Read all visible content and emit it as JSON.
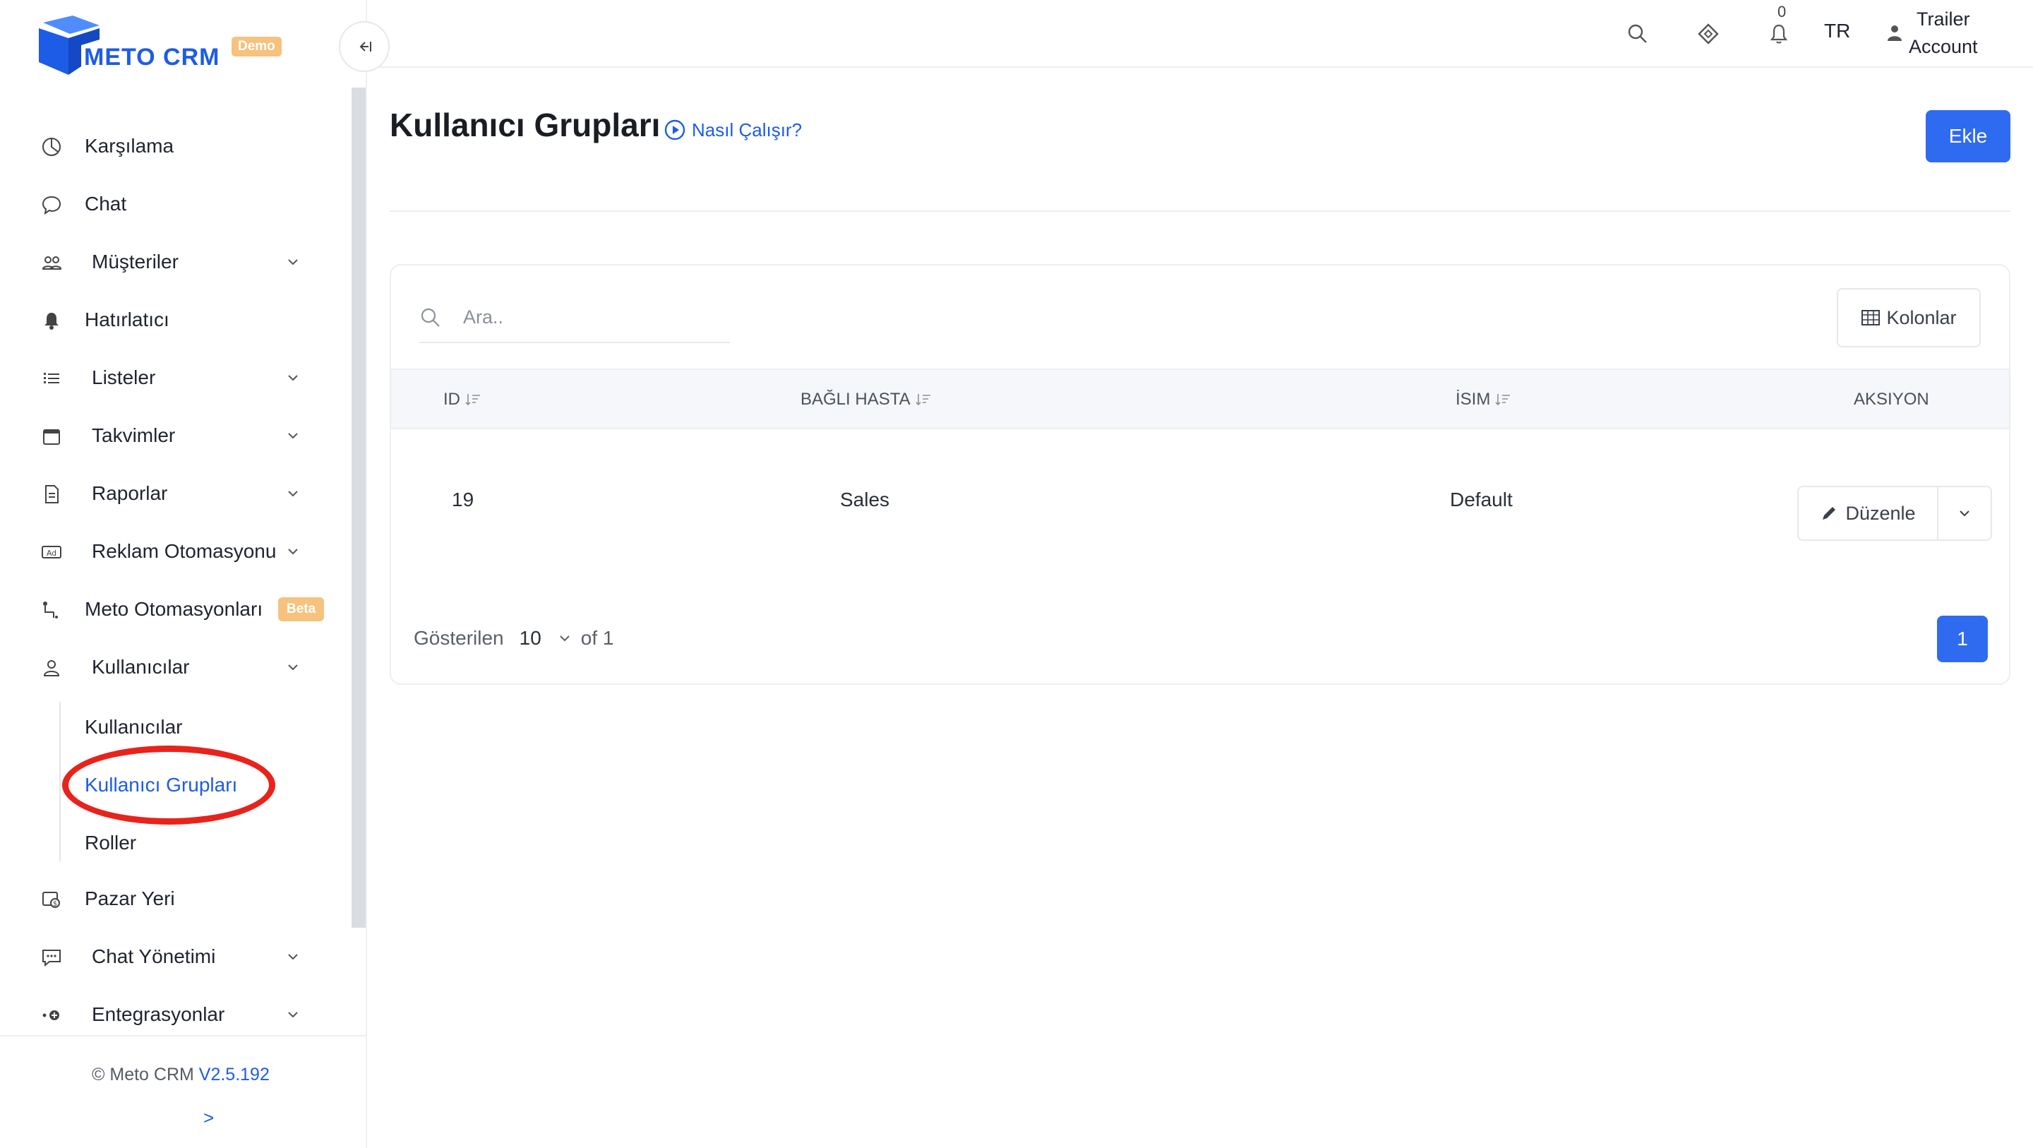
{
  "app": {
    "logo_text": "METO CRM",
    "logo_badge": "Demo",
    "brand_color": "#1d5ce6"
  },
  "sidebar": {
    "items": [
      {
        "label": "Karşılama",
        "icon": "dashboard-icon",
        "has_children": false
      },
      {
        "label": "Chat",
        "icon": "chat-bubble-icon",
        "has_children": false
      },
      {
        "label": "Müşteriler",
        "icon": "customers-icon",
        "has_children": true
      },
      {
        "label": "Hatırlatıcı",
        "icon": "bell-icon",
        "has_children": false
      },
      {
        "label": "Listeler",
        "icon": "list-icon",
        "has_children": true
      },
      {
        "label": "Takvimler",
        "icon": "calendar-icon",
        "has_children": true
      },
      {
        "label": "Raporlar",
        "icon": "report-icon",
        "has_children": true
      },
      {
        "label": "Reklam Otomasyonu",
        "icon": "ad-icon",
        "has_children": true
      },
      {
        "label": "Meto Otomasyonları",
        "icon": "automation-icon",
        "badge": "Beta"
      },
      {
        "label": "Kullanıcılar",
        "icon": "user-icon",
        "has_children": true,
        "expanded": true
      },
      {
        "label": "Pazar Yeri",
        "icon": "marketplace-icon",
        "has_children": false
      },
      {
        "label": "Chat Yönetimi",
        "icon": "chat-manage-icon",
        "has_children": true
      },
      {
        "label": "Entegrasyonlar",
        "icon": "integration-icon",
        "has_children": true
      }
    ],
    "sub_items": [
      {
        "label": "Kullanıcılar",
        "active": false
      },
      {
        "label": "Kullanıcı Grupları",
        "active": true
      },
      {
        "label": "Roller",
        "active": false
      }
    ],
    "footer": {
      "copyright": "© Meto CRM",
      "version": "V2.5.192",
      "expand_label": ">"
    }
  },
  "topbar": {
    "notification_count": "0",
    "language": "TR",
    "account_line1": "Trailer",
    "account_line2": "Account"
  },
  "page": {
    "title": "Kullanıcı Grupları",
    "how_it_works": "Nasıl Çalışır?",
    "add_button": "Ekle"
  },
  "table": {
    "search_placeholder": "Ara..",
    "columns_button": "Kolonlar",
    "headers": [
      "ID",
      "BAĞLI HASTA",
      "İSIM",
      "AKSIYON"
    ],
    "rows": [
      {
        "id": "19",
        "linked": "Sales",
        "name": "Default",
        "action": "Düzenle"
      }
    ],
    "footer": {
      "shown_label": "Gösterilen",
      "page_size": "10",
      "of_label": "of 1",
      "current_page": "1"
    }
  },
  "colors": {
    "accent": "#2f6bf0",
    "highlight_ring": "#e8231c",
    "badge": "#f6c27e"
  }
}
